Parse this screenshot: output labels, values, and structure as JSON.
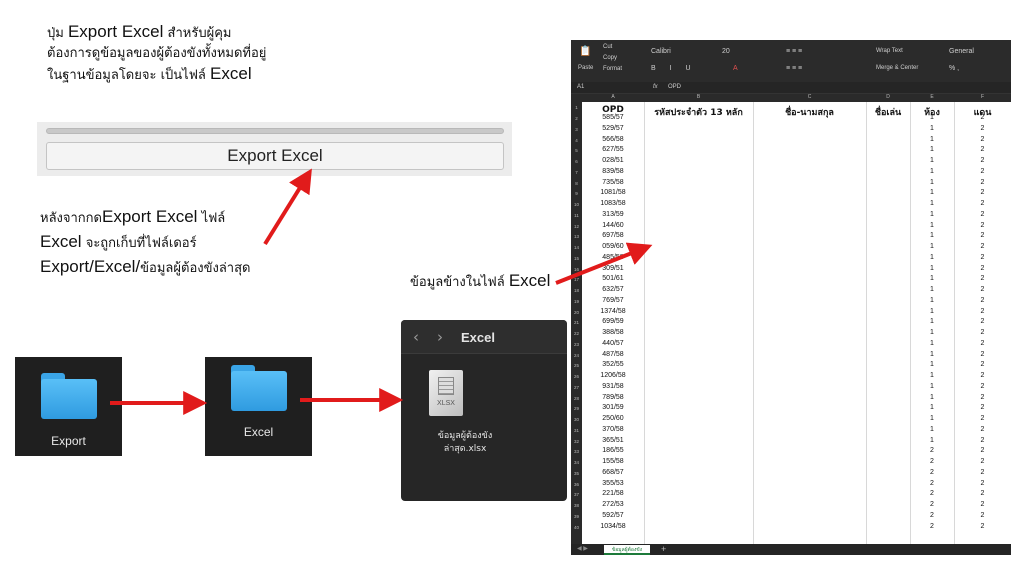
{
  "intro": {
    "line1_a": "ปุ่ม ",
    "line1_en": "Export Excel",
    "line1_b": " สำหรับผู้คุม",
    "line2": "ต้องการดูข้อมูลของผู้ต้องขังทั้งหมดที่อยู่",
    "line3_a": "ในฐานข้อมูลโดยจะ เป็นไฟล์ ",
    "line3_en": "Excel"
  },
  "after": {
    "l1_a": "หลังจากกด",
    "l1_en": "Export Excel",
    "l1_b": " ไฟล์",
    "l2_en": "Excel",
    "l2_b": " จะถูกเก็บที่ไฟล์เดอร์",
    "l3_en": "Export/Excel/",
    "l3_b": "ข้อมูลผู้ต้องขังล่าสุด"
  },
  "data_label": {
    "text": "ข้อมูลข้างในไฟล์ ",
    "en": "Excel"
  },
  "export_button": {
    "label": "Export Excel"
  },
  "folders": {
    "export": "Export",
    "excel": "Excel"
  },
  "finder": {
    "title": "Excel",
    "file_ext": "XLSX",
    "file_name_line1": "ข้อมูลผู้ต้องขัง",
    "file_name_line2": "ล่าสุด.xlsx"
  },
  "excel": {
    "ribbon": {
      "paste": "Paste",
      "cut": "Cut",
      "copy": "Copy",
      "format": "Format",
      "font": "Calibri",
      "size": "20",
      "wrap": "Wrap Text",
      "merge": "Merge & Center",
      "number_format": "General"
    },
    "cell_ref": "A1",
    "fx": "fx",
    "formula": "OPD",
    "col_letters": [
      "A",
      "B",
      "C",
      "D",
      "E",
      "F"
    ],
    "headers": [
      "OPD",
      "รหัสประจำตัว 13 หลัก",
      "ชื่อ-นามสกุล",
      "ชื่อเล่น",
      "ห้อง",
      "แดน"
    ],
    "rows": [
      [
        "585/57",
        "1",
        "2"
      ],
      [
        "529/57",
        "1",
        "2"
      ],
      [
        "566/58",
        "1",
        "2"
      ],
      [
        "627/55",
        "1",
        "2"
      ],
      [
        "028/51",
        "1",
        "2"
      ],
      [
        "839/58",
        "1",
        "2"
      ],
      [
        "735/58",
        "1",
        "2"
      ],
      [
        "1081/58",
        "1",
        "2"
      ],
      [
        "1083/58",
        "1",
        "2"
      ],
      [
        "313/59",
        "1",
        "2"
      ],
      [
        "144/60",
        "1",
        "2"
      ],
      [
        "697/58",
        "1",
        "2"
      ],
      [
        "059/60",
        "1",
        "2"
      ],
      [
        "485/58",
        "1",
        "2"
      ],
      [
        "309/51",
        "1",
        "2"
      ],
      [
        "501/61",
        "1",
        "2"
      ],
      [
        "632/57",
        "1",
        "2"
      ],
      [
        "769/57",
        "1",
        "2"
      ],
      [
        "1374/58",
        "1",
        "2"
      ],
      [
        "699/59",
        "1",
        "2"
      ],
      [
        "388/58",
        "1",
        "2"
      ],
      [
        "440/57",
        "1",
        "2"
      ],
      [
        "487/58",
        "1",
        "2"
      ],
      [
        "352/55",
        "1",
        "2"
      ],
      [
        "1206/58",
        "1",
        "2"
      ],
      [
        "931/58",
        "1",
        "2"
      ],
      [
        "789/58",
        "1",
        "2"
      ],
      [
        "301/59",
        "1",
        "2"
      ],
      [
        "250/60",
        "1",
        "2"
      ],
      [
        "370/58",
        "1",
        "2"
      ],
      [
        "365/51",
        "1",
        "2"
      ],
      [
        "186/55",
        "2",
        "2"
      ],
      [
        "155/58",
        "2",
        "2"
      ],
      [
        "668/57",
        "2",
        "2"
      ],
      [
        "355/53",
        "2",
        "2"
      ],
      [
        "221/58",
        "2",
        "2"
      ],
      [
        "272/53",
        "2",
        "2"
      ],
      [
        "592/57",
        "2",
        "2"
      ],
      [
        "1034/58",
        "2",
        "2"
      ]
    ],
    "sheet_tab": "ข้อมูลผู้ต้องขัง",
    "add_sheet": "+"
  }
}
